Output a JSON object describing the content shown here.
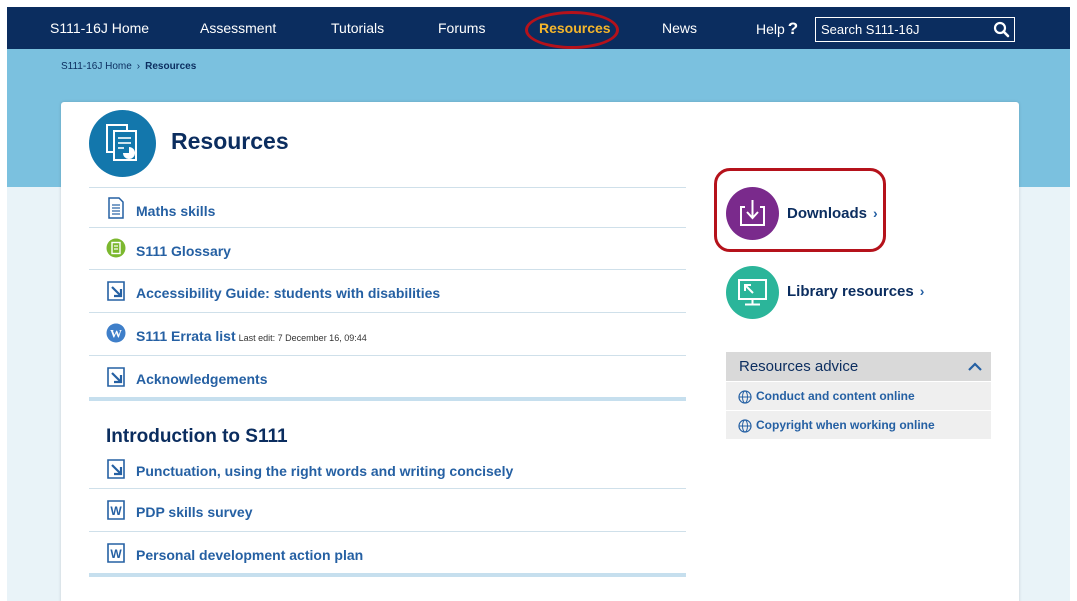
{
  "nav": {
    "home": "S111-16J Home",
    "assessment": "Assessment",
    "tutorials": "Tutorials",
    "forums": "Forums",
    "resources": "Resources",
    "news": "News",
    "help": "Help",
    "help_icon": "?",
    "search_placeholder": "Search S111-16J"
  },
  "breadcrumb": {
    "home": "S111-16J Home",
    "separator": "›",
    "current": "Resources"
  },
  "page": {
    "title": "Resources"
  },
  "resources_list": [
    {
      "label": "Maths skills",
      "icon": "document-icon"
    },
    {
      "label": "S111 Glossary",
      "icon": "glossary-icon"
    },
    {
      "label": "Accessibility Guide: students with disabilities",
      "icon": "url-arrow-icon"
    },
    {
      "label": "S111 Errata list",
      "meta": "Last edit: 7 December 16, 09:44",
      "icon": "wiki-icon"
    },
    {
      "label": "Acknowledgements",
      "icon": "url-arrow-icon"
    }
  ],
  "intro": {
    "title": "Introduction to S111",
    "items": [
      {
        "label": "Punctuation, using the right words and writing concisely",
        "icon": "url-arrow-icon"
      },
      {
        "label": "PDP skills survey",
        "icon": "word-doc-icon"
      },
      {
        "label": "Personal development action plan",
        "icon": "word-doc-icon"
      }
    ]
  },
  "side": {
    "downloads": "Downloads",
    "library": "Library resources",
    "chevron": "›"
  },
  "advice": {
    "title": "Resources advice",
    "links": [
      "Conduct and content online",
      "Copyright when working online"
    ]
  },
  "colors": {
    "nav_bg": "#0b2d5f",
    "nav_active": "#f5b62b",
    "band": "#7bc1df",
    "link": "#2560a3",
    "downloads_circle": "#7a2a8c",
    "library_circle": "#2bb59a",
    "highlight_ring": "#b5121b"
  }
}
